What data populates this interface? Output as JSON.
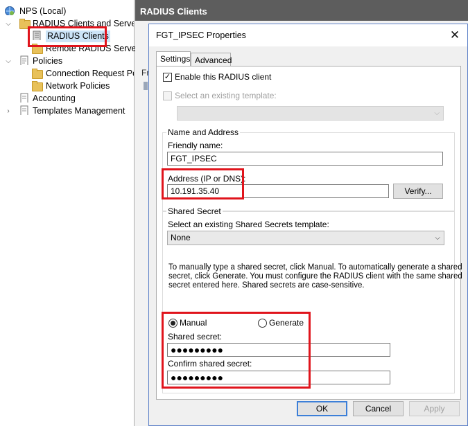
{
  "tree": {
    "root": "NPS (Local)",
    "radius_group": "RADIUS Clients and Servers",
    "radius_clients": "RADIUS Clients",
    "remote_radius": "Remote RADIUS Server",
    "policies": "Policies",
    "connection_request": "Connection Request Po",
    "network_policies": "Network Policies",
    "accounting": "Accounting",
    "templates": "Templates Management"
  },
  "pane": {
    "title": "RADIUS Clients",
    "column_fragment": "Fri"
  },
  "dialog": {
    "title": "FGT_IPSEC Properties",
    "tabs": {
      "settings": "Settings",
      "advanced": "Advanced"
    },
    "enable_label": "Enable this RADIUS client",
    "select_template_label": "Select an existing template:",
    "template_value": "",
    "name_address_group": "Name and Address",
    "friendly_name_label": "Friendly name:",
    "friendly_name_value": "FGT_IPSEC",
    "address_label": "Address (IP or DNS):",
    "address_value": "10.191.35.40",
    "verify_button": "Verify...",
    "shared_secret_group": "Shared Secret",
    "secret_template_label": "Select an existing Shared Secrets template:",
    "secret_template_value": "None",
    "help_line1": "To manually type a shared secret, click Manual. To automatically generate a shared",
    "help_line2": "secret, click Generate. You must configure the RADIUS client with the same shared",
    "help_line3": "secret entered here. Shared secrets are case-sensitive.",
    "manual_label": "Manual",
    "generate_label": "Generate",
    "shared_secret_label": "Shared secret:",
    "shared_secret_value": "●●●●●●●●●",
    "confirm_secret_label": "Confirm shared secret:",
    "confirm_secret_value": "●●●●●●●●●",
    "ok_button": "OK",
    "cancel_button": "Cancel",
    "apply_button": "Apply",
    "close_glyph": "✕"
  },
  "colors": {
    "highlight": "#e0141c",
    "header_bg": "#5d5d5d",
    "default_button_border": "#3c7fd8"
  },
  "icons": {
    "root": "nps-globe-icon",
    "folder": "folder-icon",
    "server": "server-icon",
    "policy": "policy-document-icon"
  }
}
